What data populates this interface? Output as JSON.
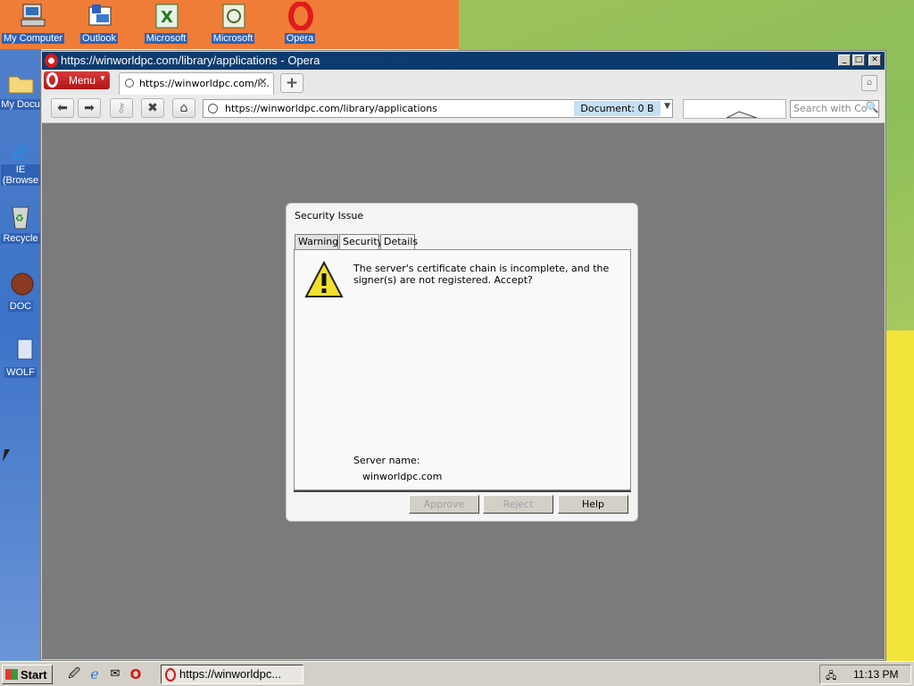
{
  "desktop": {
    "top_icons": [
      {
        "label": "My Computer",
        "icon": "computer-icon"
      },
      {
        "label": "Outlook",
        "icon": "outlook-icon"
      },
      {
        "label": "Microsoft",
        "icon": "excel-icon"
      },
      {
        "label": "Microsoft",
        "icon": "project-icon"
      },
      {
        "label": "Opera",
        "icon": "opera-icon"
      }
    ],
    "left_icons": [
      {
        "label": "My Docu",
        "icon": "folder-icon"
      },
      {
        "label": "IE\n(Browse",
        "icon": "ie-icon"
      },
      {
        "label": "Recycle",
        "icon": "recycle-bin-icon"
      },
      {
        "label": "DOC",
        "icon": "doc-icon"
      },
      {
        "label": "WOLF",
        "icon": "wolf-icon"
      }
    ],
    "colors": {
      "orange": "#ef7d37",
      "green": "#9cc25c",
      "blue": "#3d73c8",
      "yellow": "#f2e43a"
    }
  },
  "browser": {
    "window_title": "https://winworldpc.com/library/applications - Opera",
    "menu_label": "Menu",
    "tab_title": "https://winworldpc.com/l...",
    "new_tab_label": "+",
    "address": "https://winworldpc.com/library/applications",
    "document_status": "Document:   0 B",
    "search_placeholder": "Search with Co",
    "title_bar_color": "#0c3b6e",
    "menu_color": "#c62222",
    "content_bg": "#7b7b7b"
  },
  "dialog": {
    "title": "Security Issue",
    "tabs": [
      "Warning",
      "Security",
      "Details"
    ],
    "active_tab": "Warning",
    "message": "The server's certificate chain is incomplete, and the signer(s) are not registered. Accept?",
    "server_label": "Server name:",
    "server_value": "winworldpc.com",
    "buttons": {
      "approve": "Approve",
      "reject": "Reject",
      "help": "Help"
    }
  },
  "taskbar": {
    "start_label": "Start",
    "task_label": "https://winworldpc...",
    "clock": "11:13 PM"
  }
}
